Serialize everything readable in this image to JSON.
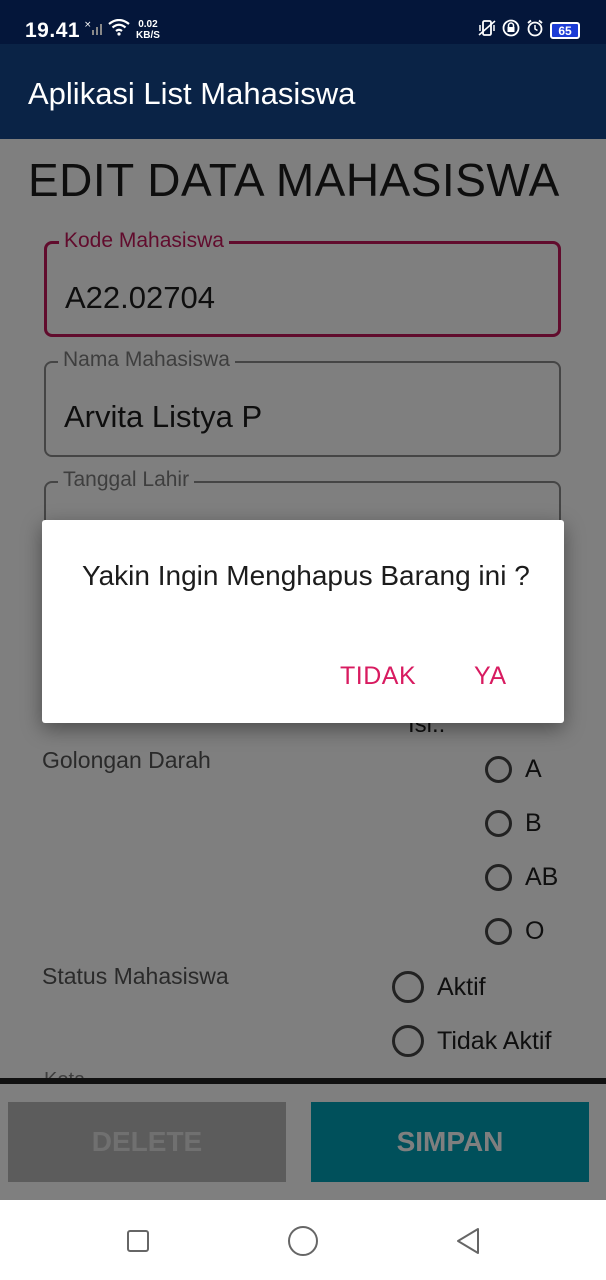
{
  "status": {
    "time": "19.41",
    "speed_value": "0.02",
    "speed_unit": "KB/S",
    "battery": "65"
  },
  "app": {
    "title": "Aplikasi List Mahasiswa"
  },
  "form": {
    "heading": "EDIT DATA MAHASISWA",
    "kode": {
      "label": "Kode Mahasiswa",
      "value": "A22.02704"
    },
    "nama": {
      "label": "Nama Mahasiswa",
      "value": "Arvita Listya P"
    },
    "tanggal": {
      "label": "Tanggal Lahir"
    },
    "agama_value": "Isi..",
    "golongan_label": "Golongan Darah",
    "golongan_options": [
      "A",
      "B",
      "AB",
      "O"
    ],
    "status_label": "Status Mahasiswa",
    "status_options": [
      "Aktif",
      "Tidak Aktif"
    ],
    "kota_label": "Kota"
  },
  "buttons": {
    "delete": "DELETE",
    "save": "SIMPAN"
  },
  "dialog": {
    "message": "Yakin Ingin Menghapus Barang ini ?",
    "negative": "TIDAK",
    "positive": "YA"
  },
  "colors": {
    "accent": "#d81b60",
    "appbar": "#0a2346",
    "save_button": "#00a0b6"
  }
}
